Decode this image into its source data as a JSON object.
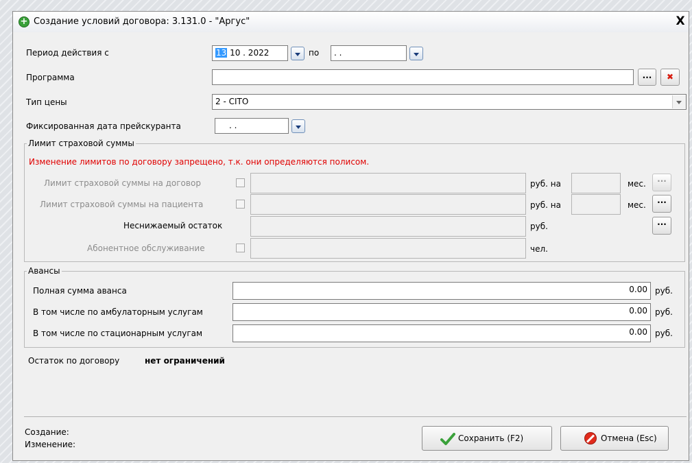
{
  "window": {
    "title": "Создание условий договора: 3.131.0 -  \"Аргус\"",
    "close_label": "X"
  },
  "period": {
    "label": "Период действия с",
    "from_day": "13",
    "from_rest": " 10 . 2022",
    "to_label": "по",
    "to_value": " .  ."
  },
  "program": {
    "label": "Программа",
    "value": "",
    "browse_label": "...",
    "clear_label": "✖"
  },
  "price_type": {
    "label": "Тип цены",
    "value": "2 - CITO"
  },
  "fixed_date": {
    "label": "Фиксированная дата прейскуранта",
    "value": ".  ."
  },
  "limits": {
    "group_title": "Лимит страховой суммы",
    "warning": "Изменение лимитов по договору запрещено, т.к. они определяются полисом.",
    "contract_label": "Лимит страховой суммы на договор",
    "contract_unit": "руб. на",
    "contract_months_unit": "мес.",
    "patient_label": "Лимит страховой суммы на пациента",
    "patient_unit": "руб. на",
    "patient_months_unit": "мес.",
    "min_balance_label": "Неснижаемый остаток",
    "min_balance_unit": "руб.",
    "subscription_label": "Абонентное обслуживание",
    "subscription_unit": "чел.",
    "browse_label": "···"
  },
  "advances": {
    "group_title": "Авансы",
    "full_label": "Полная сумма аванса",
    "full_value": "0.00",
    "outpatient_label": "В том числе по амбулаторным услугам",
    "outpatient_value": "0.00",
    "inpatient_label": "В том числе по стационарным услугам",
    "inpatient_value": "0.00",
    "unit": "руб."
  },
  "balance": {
    "label": "Остаток по договору",
    "value": "нет ограничений"
  },
  "footer": {
    "created_label": "Создание:",
    "modified_label": "Изменение:",
    "save_label": "Сохранить (F2)",
    "cancel_label": "Отмена (Esc)"
  },
  "colors": {
    "warning": "#e00000",
    "accent_selection": "#3399ff",
    "save_icon": "#3aa13a",
    "cancel_icon": "#e12b1c"
  }
}
